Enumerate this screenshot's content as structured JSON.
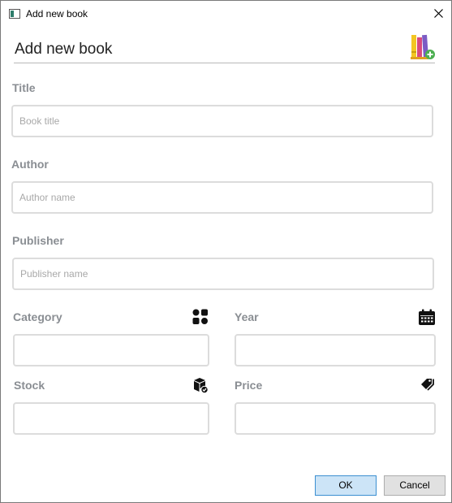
{
  "window": {
    "title": "Add new book",
    "close_icon": "close-icon"
  },
  "header": {
    "title": "Add new book",
    "icon": "books-add-icon"
  },
  "form": {
    "title_label": "Title",
    "title_placeholder": "Book title",
    "author_label": "Author",
    "author_placeholder": "Author name",
    "publisher_label": "Publisher",
    "publisher_placeholder": "Publisher name",
    "category_label": "Category",
    "category_icon": "category-grid-icon",
    "year_label": "Year",
    "year_icon": "calendar-icon",
    "stock_label": "Stock",
    "stock_icon": "boxes-icon",
    "price_label": "Price",
    "price_icon": "tag-icon"
  },
  "buttons": {
    "ok": "OK",
    "cancel": "Cancel"
  },
  "colors": {
    "label": "#8a8e93",
    "ok_bg": "#cce4f7",
    "ok_border": "#3c8fd1",
    "field_border": "#dcdcdc",
    "accent_green": "#4caf50"
  }
}
